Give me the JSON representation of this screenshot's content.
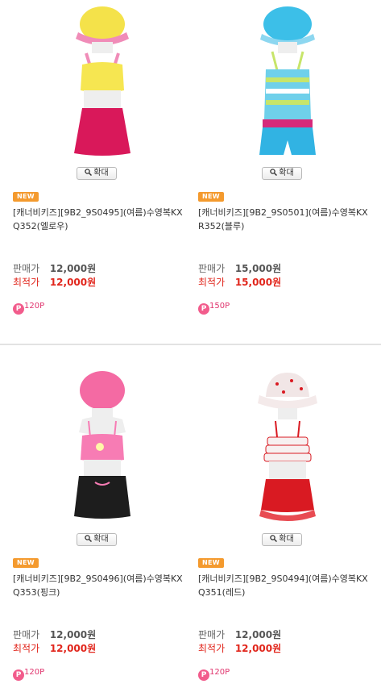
{
  "zoom_label": "확대",
  "new_label": "NEW",
  "sale_price_label": "판매가",
  "best_price_label": "최적가",
  "products": [
    {
      "title": "[캐너비키즈][9B2_9S0495](여름)수영복KXQ352(엘로우)",
      "sale_price": "12,000원",
      "best_price": "12,000원",
      "points": "120P",
      "colors": {
        "hat": "#f4e24a",
        "top": "#f6e651",
        "bottom": "#d9185a",
        "strap": "#f08cb8"
      }
    },
    {
      "title": "[캐너비키즈][9B2_9S0501](여름)수영복KXR352(블루)",
      "sale_price": "15,000원",
      "best_price": "15,000원",
      "points": "150P",
      "colors": {
        "hat": "#3cbfe8",
        "top": "#6fd0ea",
        "bottom": "#31b3e3",
        "strap": "#c7e56a"
      }
    },
    {
      "title": "[캐너비키즈][9B2_9S0496](여름)수영복KXQ353(핑크)",
      "sale_price": "12,000원",
      "best_price": "12,000원",
      "points": "120P",
      "colors": {
        "hat": "#f46aa3",
        "top": "#f77cb4",
        "bottom": "#1d1d1d",
        "strap": "#f77cb4"
      }
    },
    {
      "title": "[캐너비키즈][9B2_9S0494](여름)수영복KXQ351(레드)",
      "sale_price": "12,000원",
      "best_price": "12,000원",
      "points": "120P",
      "colors": {
        "hat": "#f1e6e6",
        "top": "#f7f0f0",
        "bottom": "#d91a22",
        "strap": "#d91a22"
      }
    }
  ]
}
